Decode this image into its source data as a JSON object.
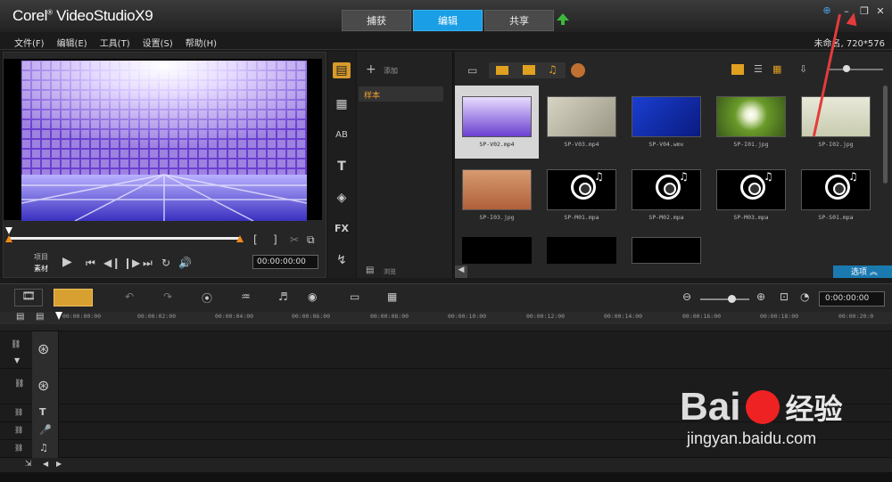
{
  "app": {
    "brand": "Corel",
    "product": "VideoStudio",
    "version": "X9"
  },
  "tabs": [
    {
      "label": "捕获"
    },
    {
      "label": "编辑"
    },
    {
      "label": "共享"
    }
  ],
  "menu": [
    {
      "label": "文件(F)"
    },
    {
      "label": "编辑(E)"
    },
    {
      "label": "工具(T)"
    },
    {
      "label": "设置(S)"
    },
    {
      "label": "帮助(H)"
    }
  ],
  "project_info": "未命名, 720*576",
  "player": {
    "mode_project": "项目",
    "mode_clip": "素材",
    "timecode": "00:00:00:00"
  },
  "library": {
    "add_label": "添加",
    "folder": "样本",
    "browse_label": "浏览",
    "options_label": "选项"
  },
  "media": [
    {
      "name": "SP-V02.mp4"
    },
    {
      "name": "SP-V03.mp4"
    },
    {
      "name": "SP-V04.wmv"
    },
    {
      "name": "SP-I01.jpg"
    },
    {
      "name": "SP-I02.jpg"
    },
    {
      "name": "SP-I03.jpg"
    },
    {
      "name": "SP-M01.mpa"
    },
    {
      "name": "SP-M02.mpa"
    },
    {
      "name": "SP-M03.mpa"
    },
    {
      "name": "SP-S01.mpa"
    }
  ],
  "timeline": {
    "timecode": "0:00:00:00",
    "ticks": [
      "00:00:00:00",
      "00:00:02:00",
      "00:00:04:00",
      "00:00:06:00",
      "00:00:08:00",
      "00:00:10:00",
      "00:00:12:00",
      "00:00:14:00",
      "00:00:16:00",
      "00:00:18:00",
      "00:00:20:0"
    ]
  },
  "watermark": {
    "brand": "Bai",
    "brand2": "经验",
    "url": "jingyan.baidu.com"
  },
  "colors": {
    "accent": "#1a9ee6",
    "arrow": "#e53b3b"
  }
}
